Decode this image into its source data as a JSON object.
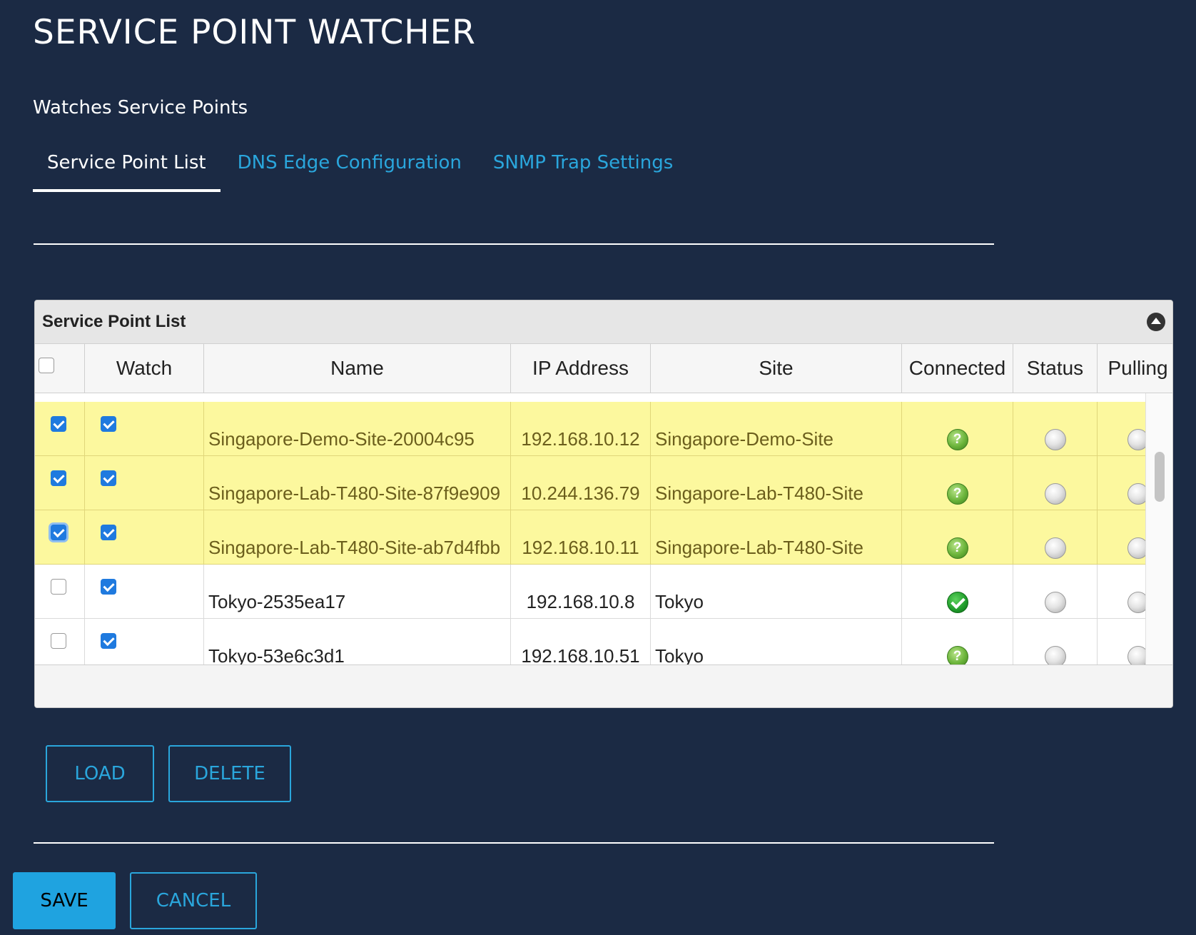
{
  "header": {
    "title": "SERVICE POINT WATCHER",
    "subtitle": "Watches Service Points"
  },
  "tabs": [
    {
      "label": "Service Point List",
      "active": true
    },
    {
      "label": "DNS Edge Configuration",
      "active": false
    },
    {
      "label": "SNMP Trap Settings",
      "active": false
    }
  ],
  "panel": {
    "title": "Service Point List",
    "columns": [
      "",
      "Watch",
      "Name",
      "IP Address",
      "Site",
      "Connected",
      "Status",
      "Pulling"
    ],
    "rows": [
      {
        "selected": true,
        "watch": true,
        "name": "Singapore-Demo-Site-20004c95",
        "ip": "192.168.10.12",
        "site": "Singapore-Demo-Site",
        "connected": "unknown",
        "status": "gray",
        "pulling": "gray"
      },
      {
        "selected": true,
        "watch": true,
        "name": "Singapore-Lab-T480-Site-87f9e909",
        "ip": "10.244.136.79",
        "site": "Singapore-Lab-T480-Site",
        "connected": "unknown",
        "status": "gray",
        "pulling": "gray"
      },
      {
        "selected": true,
        "watch": true,
        "name": "Singapore-Lab-T480-Site-ab7d4fbb",
        "ip": "192.168.10.11",
        "site": "Singapore-Lab-T480-Site",
        "connected": "unknown",
        "status": "gray",
        "pulling": "gray"
      },
      {
        "selected": false,
        "watch": true,
        "name": "Tokyo-2535ea17",
        "ip": "192.168.10.8",
        "site": "Tokyo",
        "connected": "ok",
        "status": "gray",
        "pulling": "gray"
      },
      {
        "selected": false,
        "watch": true,
        "name": "Tokyo-53e6c3d1",
        "ip": "192.168.10.51",
        "site": "Tokyo",
        "connected": "unknown",
        "status": "gray",
        "pulling": "gray"
      }
    ]
  },
  "actions": {
    "load": "LOAD",
    "delete": "DELETE",
    "save": "SAVE",
    "cancel": "CANCEL"
  },
  "colors": {
    "background": "#1b2a44",
    "accent": "#2aa6dc",
    "selected_row": "#fcf89e"
  }
}
